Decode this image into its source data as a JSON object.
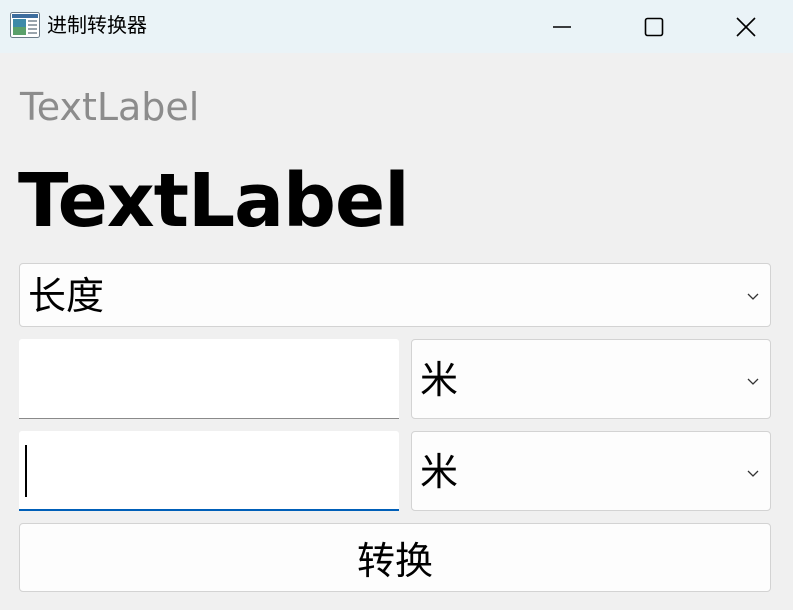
{
  "window": {
    "title": "进制转换器",
    "controls": [
      "minimize-icon",
      "maximize-icon",
      "close-icon"
    ]
  },
  "labels": {
    "subtitle": "TextLabel",
    "result": "TextLabel"
  },
  "category_select": {
    "selected": "长度"
  },
  "input_from": {
    "value": "",
    "unit_selected": "米"
  },
  "input_to": {
    "value": "",
    "unit_selected": "米"
  },
  "convert_button": {
    "label": "转换"
  },
  "colors": {
    "titlebar_bg": "#eaf3f7",
    "window_bg": "#f0f0f0",
    "focus_accent": "#005fb8",
    "muted_label": "#8c8c8c"
  }
}
